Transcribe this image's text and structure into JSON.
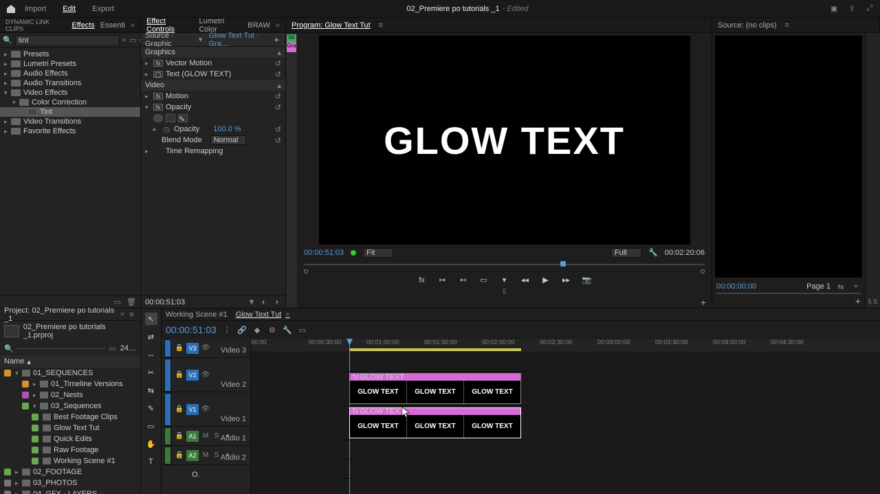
{
  "titlebar": {
    "modes": {
      "import": "Import",
      "edit": "Edit",
      "export": "Export"
    },
    "doc_title": "02_Premiere po tutorials _1",
    "doc_status": "- Edited"
  },
  "workspace": {
    "left_label": "DYNAMIC LINK CLIPS",
    "left_tabs": {
      "effects": "Effects",
      "essent": "Essenti"
    },
    "ec_tabs": {
      "ec": "Effect Controls",
      "lumetri": "Lumetri Color",
      "braw": "BRAW"
    },
    "program_label": "Program: Glow Text Tut",
    "source_label": "Source: (no clips)"
  },
  "effects": {
    "search_value": "tint",
    "tree": {
      "presets": "Presets",
      "lumetri_presets": "Lumetri Presets",
      "audio_effects": "Audio Effects",
      "audio_transitions": "Audio Transitions",
      "video_effects": "Video Effects",
      "color_correction": "Color Correction",
      "tint": "Tint",
      "video_transitions": "Video Transitions",
      "favorite_effects": "Favorite Effects"
    }
  },
  "effect_controls": {
    "source_label": "Source · Graphic",
    "seq_label": "Glow Text Tut · Gra…",
    "mini_time": "00",
    "mini_clip": "Gra",
    "graphics_section": "Graphics",
    "items": {
      "vector_motion": "Vector Motion",
      "text_layer": "Text (GLOW TEXT)",
      "video_section": "Video",
      "motion": "Motion",
      "opacity": "Opacity",
      "opacity_prop": "Opacity",
      "opacity_val": "100.0 %",
      "blend_mode": "Blend Mode",
      "blend_val": "Normal",
      "time_remap": "Time Remapping"
    },
    "footer_tc": "00:00:51:03"
  },
  "program": {
    "preview_text": "GLOW TEXT",
    "tc_left": "00:00:51:03",
    "fit": "Fit",
    "res": "Full",
    "tc_right": "00:02:20:06"
  },
  "source": {
    "tc": "00:00:00:00",
    "page": "Page 1",
    "s5": "5 S"
  },
  "project": {
    "tab": "Project: 02_Premiere po tutorials _1",
    "filename": "02_Premiere po tutorials _1.prproj",
    "count": "24…",
    "name_col": "Name",
    "bins": {
      "seq_folder": "01_SEQUENCES",
      "tl_versions": "01_Timeline Versions",
      "nests": "02_Nests",
      "sequences": "03_Sequences",
      "best": "Best Footage Clips",
      "glow": "Glow Text Tut",
      "quick": "Quick Edits",
      "raw": "Raw Footage",
      "working": "Working Scene #1",
      "footage": "02_FOOTAGE",
      "photos": "03_PHOTOS",
      "gfx": "04_GFX · LAYERS ·"
    }
  },
  "timeline": {
    "tabs": {
      "working": "Working Scene #1",
      "glow": "Glow Text Tut"
    },
    "tc": "00:00:51:03",
    "ruler": [
      "00:00",
      "00:00:30:00",
      "00:01:00:00",
      "00:01:30:00",
      "00:02:00:00",
      "00:02:30:00",
      "00:03:00:00",
      "00:03:30:00",
      "00:04:00:00",
      "00:04:30:00"
    ],
    "tracks": {
      "v3": "V3",
      "v2": "V2",
      "v1": "V1",
      "a1": "A1",
      "a2": "A2",
      "video3": "Video 3",
      "video2": "Video 2",
      "video1": "Video 1",
      "audio1": "Audio 1",
      "audio2": "Audio 2"
    },
    "clip_header": "GLOW TEXT",
    "clip_frame": "GLOW TEXT",
    "o": "O.",
    "fx_lbl": "fx"
  }
}
